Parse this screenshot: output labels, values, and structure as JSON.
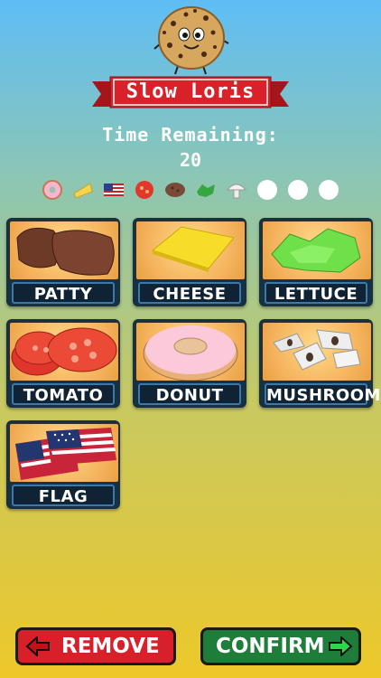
{
  "game": {
    "player_name": "Slow Loris",
    "timer_label": "Time Remaining:",
    "timer_value": "20"
  },
  "order_slots": [
    {
      "icon": "donut-icon"
    },
    {
      "icon": "cheese-icon"
    },
    {
      "icon": "flag-icon"
    },
    {
      "icon": "tomato-icon"
    },
    {
      "icon": "patty-icon"
    },
    {
      "icon": "lettuce-icon"
    },
    {
      "icon": "mushroom-icon"
    },
    {
      "icon": "empty"
    },
    {
      "icon": "empty"
    },
    {
      "icon": "empty"
    }
  ],
  "ingredients": [
    {
      "label": "PATTY"
    },
    {
      "label": "CHEESE"
    },
    {
      "label": "LETTUCE"
    },
    {
      "label": "TOMATO"
    },
    {
      "label": "DONUT"
    },
    {
      "label": "MUSHROOM"
    },
    {
      "label": "FLAG"
    }
  ],
  "actions": {
    "remove_label": "REMOVE",
    "confirm_label": "CONFIRM"
  },
  "colors": {
    "remove": "#d8202a",
    "confirm": "#1f7d3a",
    "banner": "#d82128"
  }
}
